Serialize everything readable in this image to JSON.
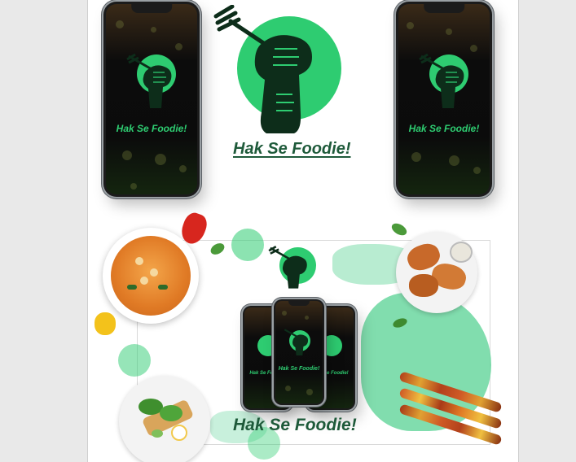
{
  "brand": {
    "name": "Hak Se Foodie!"
  },
  "colors": {
    "brand_green": "#2ecc71",
    "title_dark_green": "#1e5a3a",
    "phone_bg": "#0b0b0b"
  },
  "sections": {
    "top_mockup": {
      "phones": [
        "left-phone",
        "right-phone"
      ],
      "logo_icon": "fist-fork-icon"
    },
    "bottom_poster": {
      "phones": [
        "back-left-phone",
        "front-phone",
        "back-right-phone"
      ],
      "food_items": [
        "curry-bowl",
        "grilled-chicken-plate",
        "salad-plate",
        "kebab-skewers"
      ]
    }
  }
}
